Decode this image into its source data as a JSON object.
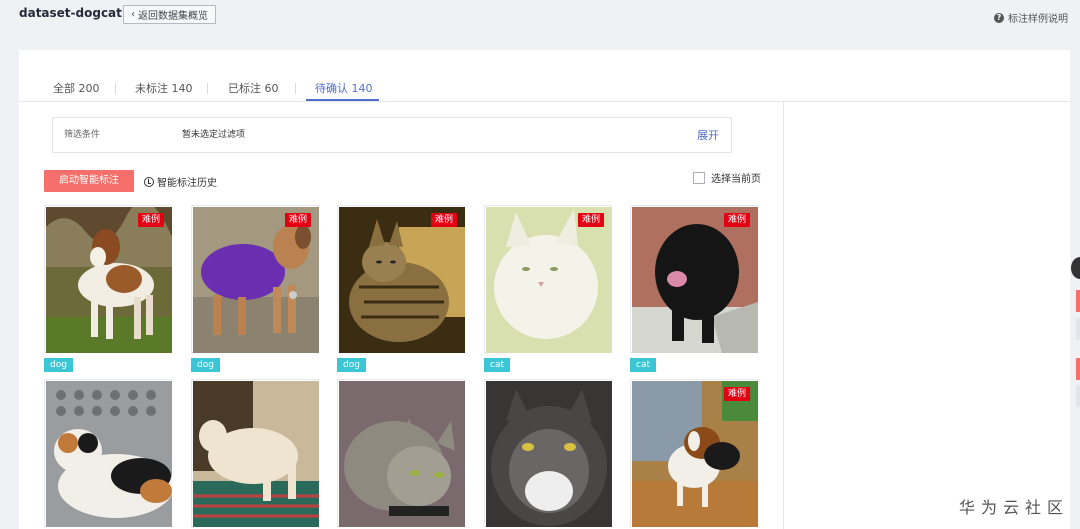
{
  "header": {
    "dataset_title": "dataset-dogcat",
    "back_label": "返回数据集概览",
    "help_label": "标注样例说明"
  },
  "tabs": [
    {
      "label": "全部 200",
      "active": false
    },
    {
      "label": "未标注 140",
      "active": false
    },
    {
      "label": "已标注 60",
      "active": false
    },
    {
      "label": "待确认 140",
      "active": true
    }
  ],
  "filter": {
    "label": "筛选条件",
    "value": "暂未选定过滤项",
    "expand_label": "展开"
  },
  "actions": {
    "auto_label_button": "启动智能标注",
    "history_label": "智能标注历史",
    "select_page_label": "选择当前页"
  },
  "hard_badge_text": "难例",
  "images": [
    {
      "subject": "dog",
      "hard": true,
      "label": "dog"
    },
    {
      "subject": "dog-purple",
      "hard": true,
      "label": "dog"
    },
    {
      "subject": "tabby-kitten",
      "hard": true,
      "label": "dog"
    },
    {
      "subject": "white-cat",
      "hard": true,
      "label": "cat"
    },
    {
      "subject": "black-dog",
      "hard": true,
      "label": "cat"
    },
    {
      "subject": "calico-cat",
      "hard": false,
      "label": ""
    },
    {
      "subject": "cream-cat",
      "hard": false,
      "label": ""
    },
    {
      "subject": "gray-tabby",
      "hard": false,
      "label": ""
    },
    {
      "subject": "fluffy-cat",
      "hard": false,
      "label": ""
    },
    {
      "subject": "beagle",
      "hard": true,
      "label": ""
    }
  ],
  "watermark": "华为云社区",
  "colors": {
    "accent": "#526ecc",
    "danger_button": "#f66f6a",
    "hard_badge": "#e30012",
    "label_tag": "#3bc6d6"
  }
}
